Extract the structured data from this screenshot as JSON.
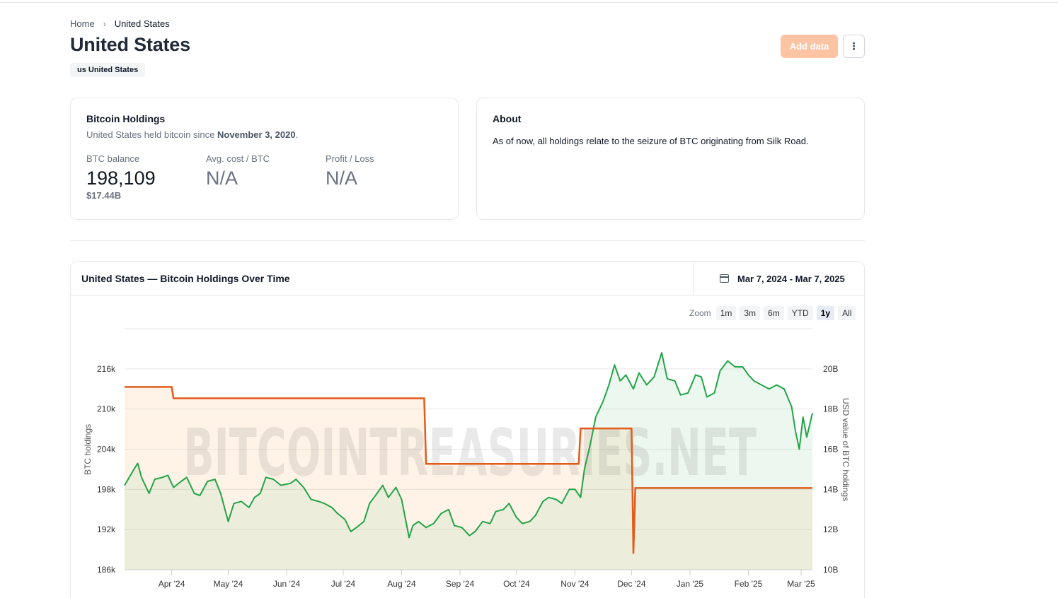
{
  "breadcrumb": {
    "home": "Home",
    "current": "United States"
  },
  "page": {
    "title": "United States",
    "badge": "us United States"
  },
  "actions": {
    "add_data": "Add data",
    "more": "⋮"
  },
  "holdings": {
    "title": "Bitcoin Holdings",
    "since_prefix": "United States held bitcoin since ",
    "since_date": "November 3, 2020",
    "since_suffix": ".",
    "btc_balance_label": "BTC balance",
    "btc_balance_value": "198,109",
    "btc_balance_usd": "$17.44B",
    "avg_cost_label": "Avg. cost / BTC",
    "avg_cost_value": "N/A",
    "profit_label": "Profit / Loss",
    "profit_value": "N/A"
  },
  "about": {
    "title": "About",
    "text": "As of now, all holdings relate to the seizure of BTC originating from Silk Road."
  },
  "chart_section": {
    "title": "United States — Bitcoin Holdings Over Time",
    "date_range": "Mar 7, 2024 - Mar 7, 2025",
    "zoom_label": "Zoom",
    "zoom_options": [
      "1m",
      "3m",
      "6m",
      "YTD",
      "1y",
      "All"
    ],
    "zoom_active": "1y",
    "watermark": "BITCOINTREASURIES.NET"
  },
  "chart_data": {
    "type": "line",
    "x_range": [
      "2024-03-07",
      "2025-03-07"
    ],
    "x_tick_labels": [
      "Apr '24",
      "May '24",
      "Jun '24",
      "Jul '24",
      "Aug '24",
      "Sep '24",
      "Oct '24",
      "Nov '24",
      "Dec '24",
      "Jan '25",
      "Feb '25",
      "Mar '25"
    ],
    "y_left": {
      "label": "BTC holdings",
      "range": [
        186000,
        222000
      ],
      "ticks": [
        186000,
        192000,
        198000,
        204000,
        210000,
        216000
      ],
      "tick_labels": [
        "186k",
        "192k",
        "198k",
        "204k",
        "210k",
        "216k"
      ]
    },
    "y_right": {
      "label": "USD value of BTC holdings",
      "range": [
        10,
        22
      ],
      "unit": "B",
      "ticks": [
        10,
        12,
        14,
        16,
        18,
        20
      ],
      "tick_labels": [
        "10B",
        "12B",
        "14B",
        "16B",
        "18B",
        "20B"
      ]
    },
    "colors": {
      "holdings": "#e35b1a",
      "usd_value": "#22a447"
    },
    "series": [
      {
        "axis": "left",
        "style": "step",
        "points": [
          [
            "2024-03-07",
            213300
          ],
          [
            "2024-04-01",
            213300
          ],
          [
            "2024-04-02",
            211600
          ],
          [
            "2024-08-13",
            211600
          ],
          [
            "2024-08-14",
            201800
          ],
          [
            "2024-11-03",
            201800
          ],
          [
            "2024-11-04",
            207100
          ],
          [
            "2024-12-01",
            207100
          ],
          [
            "2024-12-02",
            188400
          ],
          [
            "2024-12-03",
            198200
          ],
          [
            "2025-03-07",
            198200
          ]
        ]
      },
      {
        "axis": "right",
        "style": "line",
        "points": [
          [
            "2024-03-07",
            14.2
          ],
          [
            "2024-03-12",
            15.0
          ],
          [
            "2024-03-14",
            15.3
          ],
          [
            "2024-03-16",
            14.6
          ],
          [
            "2024-03-20",
            13.8
          ],
          [
            "2024-03-23",
            14.5
          ],
          [
            "2024-03-27",
            14.6
          ],
          [
            "2024-03-30",
            14.7
          ],
          [
            "2024-04-02",
            14.1
          ],
          [
            "2024-04-06",
            14.4
          ],
          [
            "2024-04-09",
            14.6
          ],
          [
            "2024-04-13",
            13.8
          ],
          [
            "2024-04-16",
            13.7
          ],
          [
            "2024-04-20",
            14.4
          ],
          [
            "2024-04-24",
            14.5
          ],
          [
            "2024-04-27",
            13.8
          ],
          [
            "2024-05-01",
            12.4
          ],
          [
            "2024-05-04",
            13.3
          ],
          [
            "2024-05-08",
            13.4
          ],
          [
            "2024-05-12",
            13.1
          ],
          [
            "2024-05-15",
            13.6
          ],
          [
            "2024-05-18",
            13.8
          ],
          [
            "2024-05-21",
            14.6
          ],
          [
            "2024-05-25",
            14.5
          ],
          [
            "2024-05-29",
            14.2
          ],
          [
            "2024-06-03",
            14.3
          ],
          [
            "2024-06-06",
            14.5
          ],
          [
            "2024-06-10",
            14.1
          ],
          [
            "2024-06-14",
            13.5
          ],
          [
            "2024-06-18",
            13.4
          ],
          [
            "2024-06-21",
            13.3
          ],
          [
            "2024-06-25",
            13.1
          ],
          [
            "2024-06-28",
            12.8
          ],
          [
            "2024-07-02",
            12.5
          ],
          [
            "2024-07-05",
            11.9
          ],
          [
            "2024-07-08",
            12.1
          ],
          [
            "2024-07-12",
            12.4
          ],
          [
            "2024-07-15",
            13.3
          ],
          [
            "2024-07-19",
            13.8
          ],
          [
            "2024-07-22",
            14.2
          ],
          [
            "2024-07-25",
            13.6
          ],
          [
            "2024-07-29",
            14.1
          ],
          [
            "2024-08-01",
            13.5
          ],
          [
            "2024-08-05",
            11.6
          ],
          [
            "2024-08-07",
            12.2
          ],
          [
            "2024-08-10",
            12.4
          ],
          [
            "2024-08-14",
            12.1
          ],
          [
            "2024-08-18",
            12.3
          ],
          [
            "2024-08-22",
            12.8
          ],
          [
            "2024-08-26",
            13.0
          ],
          [
            "2024-08-29",
            12.2
          ],
          [
            "2024-09-02",
            12.1
          ],
          [
            "2024-09-06",
            11.7
          ],
          [
            "2024-09-09",
            11.9
          ],
          [
            "2024-09-13",
            12.4
          ],
          [
            "2024-09-17",
            12.3
          ],
          [
            "2024-09-20",
            12.9
          ],
          [
            "2024-09-24",
            13.0
          ],
          [
            "2024-09-27",
            13.3
          ],
          [
            "2024-10-01",
            12.6
          ],
          [
            "2024-10-04",
            12.3
          ],
          [
            "2024-10-08",
            12.4
          ],
          [
            "2024-10-11",
            12.7
          ],
          [
            "2024-10-15",
            13.4
          ],
          [
            "2024-10-18",
            13.6
          ],
          [
            "2024-10-22",
            13.5
          ],
          [
            "2024-10-25",
            13.3
          ],
          [
            "2024-10-29",
            14.0
          ],
          [
            "2024-11-01",
            14.0
          ],
          [
            "2024-11-04",
            13.6
          ],
          [
            "2024-11-06",
            15.0
          ],
          [
            "2024-11-09",
            16.2
          ],
          [
            "2024-11-12",
            17.6
          ],
          [
            "2024-11-16",
            18.4
          ],
          [
            "2024-11-19",
            19.2
          ],
          [
            "2024-11-22",
            20.2
          ],
          [
            "2024-11-25",
            19.4
          ],
          [
            "2024-11-28",
            19.7
          ],
          [
            "2024-12-02",
            19.0
          ],
          [
            "2024-12-05",
            19.8
          ],
          [
            "2024-12-09",
            19.2
          ],
          [
            "2024-12-13",
            19.6
          ],
          [
            "2024-12-17",
            20.8
          ],
          [
            "2024-12-20",
            19.5
          ],
          [
            "2024-12-24",
            19.4
          ],
          [
            "2024-12-27",
            18.7
          ],
          [
            "2024-12-31",
            18.8
          ],
          [
            "2025-01-04",
            19.7
          ],
          [
            "2025-01-07",
            19.6
          ],
          [
            "2025-01-10",
            18.6
          ],
          [
            "2025-01-14",
            18.8
          ],
          [
            "2025-01-17",
            19.9
          ],
          [
            "2025-01-21",
            20.4
          ],
          [
            "2025-01-25",
            20.1
          ],
          [
            "2025-01-29",
            20.1
          ],
          [
            "2025-02-01",
            19.7
          ],
          [
            "2025-02-04",
            19.4
          ],
          [
            "2025-02-08",
            19.2
          ],
          [
            "2025-02-12",
            19.0
          ],
          [
            "2025-02-16",
            19.2
          ],
          [
            "2025-02-20",
            19.0
          ],
          [
            "2025-02-24",
            18.1
          ],
          [
            "2025-02-26",
            16.9
          ],
          [
            "2025-02-28",
            16.0
          ],
          [
            "2025-03-02",
            17.6
          ],
          [
            "2025-03-04",
            16.6
          ],
          [
            "2025-03-07",
            17.8
          ]
        ]
      }
    ],
    "grid": true,
    "legend": "none"
  }
}
